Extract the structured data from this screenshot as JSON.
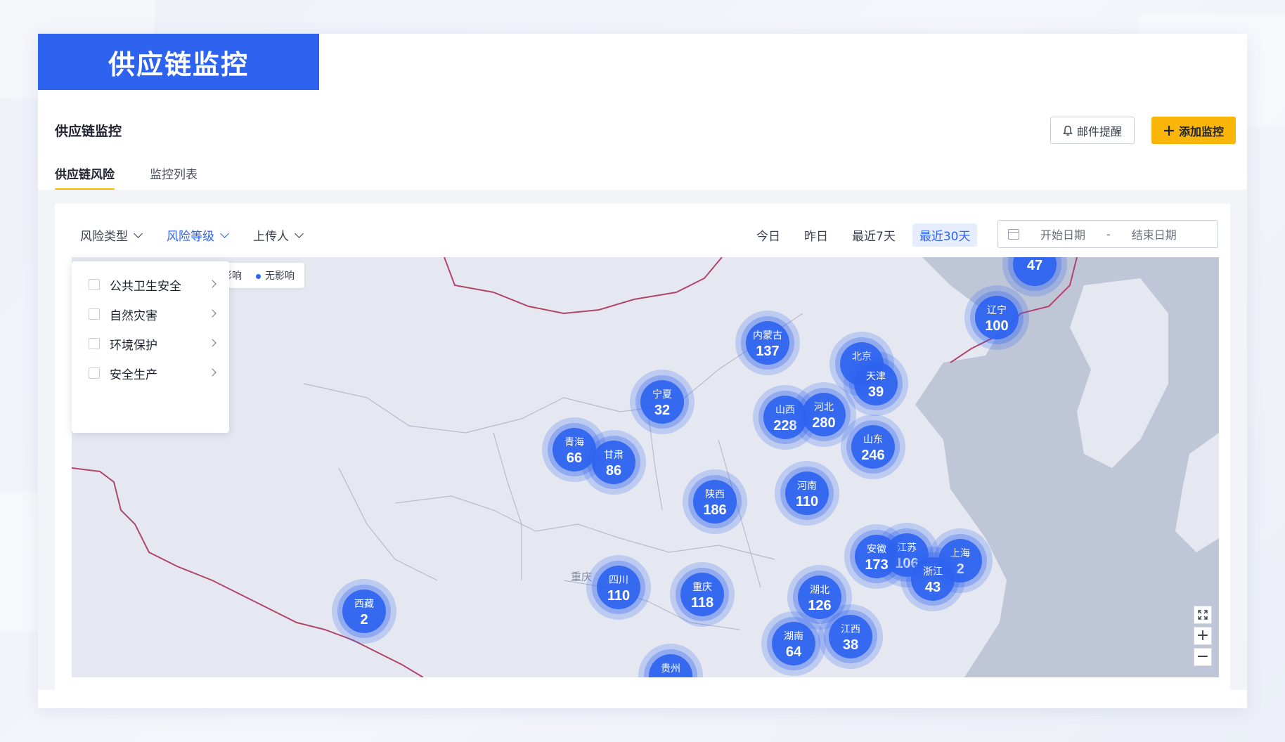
{
  "banner": {
    "title": "供应链监控"
  },
  "header": {
    "title": "供应链监控",
    "mail_button": "邮件提醒",
    "add_button": "添加监控"
  },
  "tabs": [
    {
      "label": "供应链风险",
      "active": true
    },
    {
      "label": "监控列表",
      "active": false
    }
  ],
  "filters": [
    {
      "label": "风险类型",
      "active": false
    },
    {
      "label": "风险等级",
      "active": true
    },
    {
      "label": "上传人",
      "active": false
    }
  ],
  "quick_dates": [
    {
      "label": "今日",
      "active": false
    },
    {
      "label": "昨日",
      "active": false
    },
    {
      "label": "最近7天",
      "active": false
    },
    {
      "label": "最近30天",
      "active": true
    }
  ],
  "date_range": {
    "start_placeholder": "开始日期",
    "separator": "-",
    "end_placeholder": "结束日期"
  },
  "risk_type_dropdown": [
    {
      "label": "公共卫生安全"
    },
    {
      "label": "自然灾害"
    },
    {
      "label": "环境保护"
    },
    {
      "label": "安全生产"
    }
  ],
  "legend": {
    "partial_label": "影响",
    "label": "无影响"
  },
  "map": {
    "label_chongqing": "重庆",
    "colors": {
      "land": "#e6e8f1",
      "sea": "#bfc6d8",
      "border": "#b0456a",
      "cluster": "#2e63f0"
    },
    "clusters": [
      {
        "name": "",
        "count": "47"
      },
      {
        "name": "辽宁",
        "count": "100"
      },
      {
        "name": "内蒙古",
        "count": "137"
      },
      {
        "name": "北京",
        "count": ""
      },
      {
        "name": "天津",
        "count": "39"
      },
      {
        "name": "宁夏",
        "count": "32"
      },
      {
        "name": "山西",
        "count": "228"
      },
      {
        "name": "河北",
        "count": "280"
      },
      {
        "name": "山东",
        "count": "246"
      },
      {
        "name": "青海",
        "count": "66"
      },
      {
        "name": "甘肃",
        "count": "86"
      },
      {
        "name": "陕西",
        "count": "186"
      },
      {
        "name": "河南",
        "count": "110"
      },
      {
        "name": "江苏",
        "count": "106"
      },
      {
        "name": "上海",
        "count": "2"
      },
      {
        "name": "安徽",
        "count": "173"
      },
      {
        "name": "浙江",
        "count": "43"
      },
      {
        "name": "四川",
        "count": "110"
      },
      {
        "name": "重庆",
        "count": "118"
      },
      {
        "name": "湖北",
        "count": "126"
      },
      {
        "name": "西藏",
        "count": "2"
      },
      {
        "name": "江西",
        "count": "38"
      },
      {
        "name": "湖南",
        "count": "64"
      },
      {
        "name": "贵州",
        "count": ""
      }
    ]
  },
  "map_controls": {
    "expand_icon": "expand-icon",
    "zoom_in": "+",
    "zoom_out": "−"
  }
}
